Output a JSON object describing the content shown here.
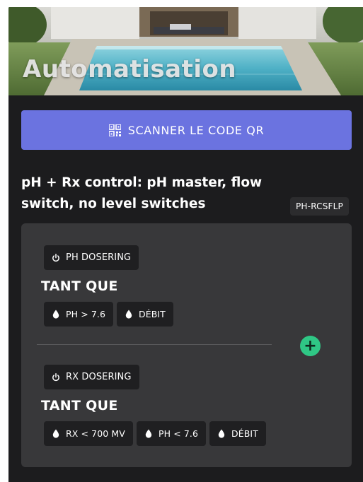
{
  "hero": {
    "title": "Automatisation"
  },
  "scan_button": {
    "label": "SCANNER LE CODE QR",
    "icon": "qr-code-icon"
  },
  "program": {
    "title": "pH + Rx control: pH master, flow switch, no level switches",
    "code": "PH-RCSFLP"
  },
  "rules": [
    {
      "action": {
        "label": "PH DOSERING",
        "icon": "power-icon"
      },
      "while_label": "TANT QUE",
      "conditions": [
        {
          "label": "PH > 7.6",
          "icon": "droplet-icon"
        },
        {
          "label": "DÉBIT",
          "icon": "droplet-icon"
        }
      ]
    },
    {
      "action": {
        "label": "RX DOSERING",
        "icon": "power-icon"
      },
      "while_label": "TANT QUE",
      "conditions": [
        {
          "label": "RX < 700 MV",
          "icon": "droplet-icon"
        },
        {
          "label": "PH < 7.6",
          "icon": "droplet-icon"
        },
        {
          "label": "DÉBIT",
          "icon": "droplet-icon"
        }
      ]
    }
  ],
  "add_button": {
    "label": "+",
    "icon": "plus-icon"
  },
  "colors": {
    "background": "#1c1c1e",
    "card": "#38383a",
    "chip": "#1f1f21",
    "accent": "#6b73e0",
    "add": "#2fc785"
  }
}
